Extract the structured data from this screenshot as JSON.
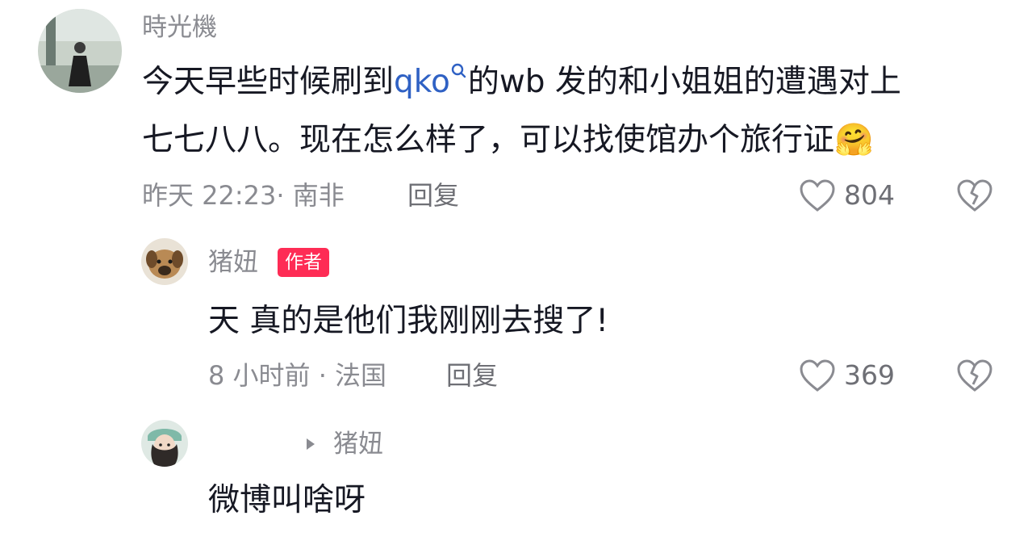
{
  "comment": {
    "username": "時光機",
    "text_before_link": "今天早些时候刷到",
    "link": "qko",
    "text_after_link": "的wb 发的和小姐姐的遭遇对上",
    "line2": "七七八八。现在怎么样了，可以找使馆办个旅行证",
    "emoji": "🤗",
    "time_location": "昨天 22:23· 南非",
    "reply_label": "回复",
    "likes": "804"
  },
  "reply1": {
    "username": "猪妞",
    "badge": "作者",
    "text": "天 真的是他们我刚刚去搜了!",
    "time_location": "8 小时前 · 法国",
    "reply_label": "回复",
    "likes": "369"
  },
  "reply2": {
    "reply_to": "猪妞",
    "text": "微博叫啥呀"
  },
  "colors": {
    "link": "#2f61c4",
    "badge": "#fe2c55",
    "secondary_text": "#8a8b91"
  }
}
